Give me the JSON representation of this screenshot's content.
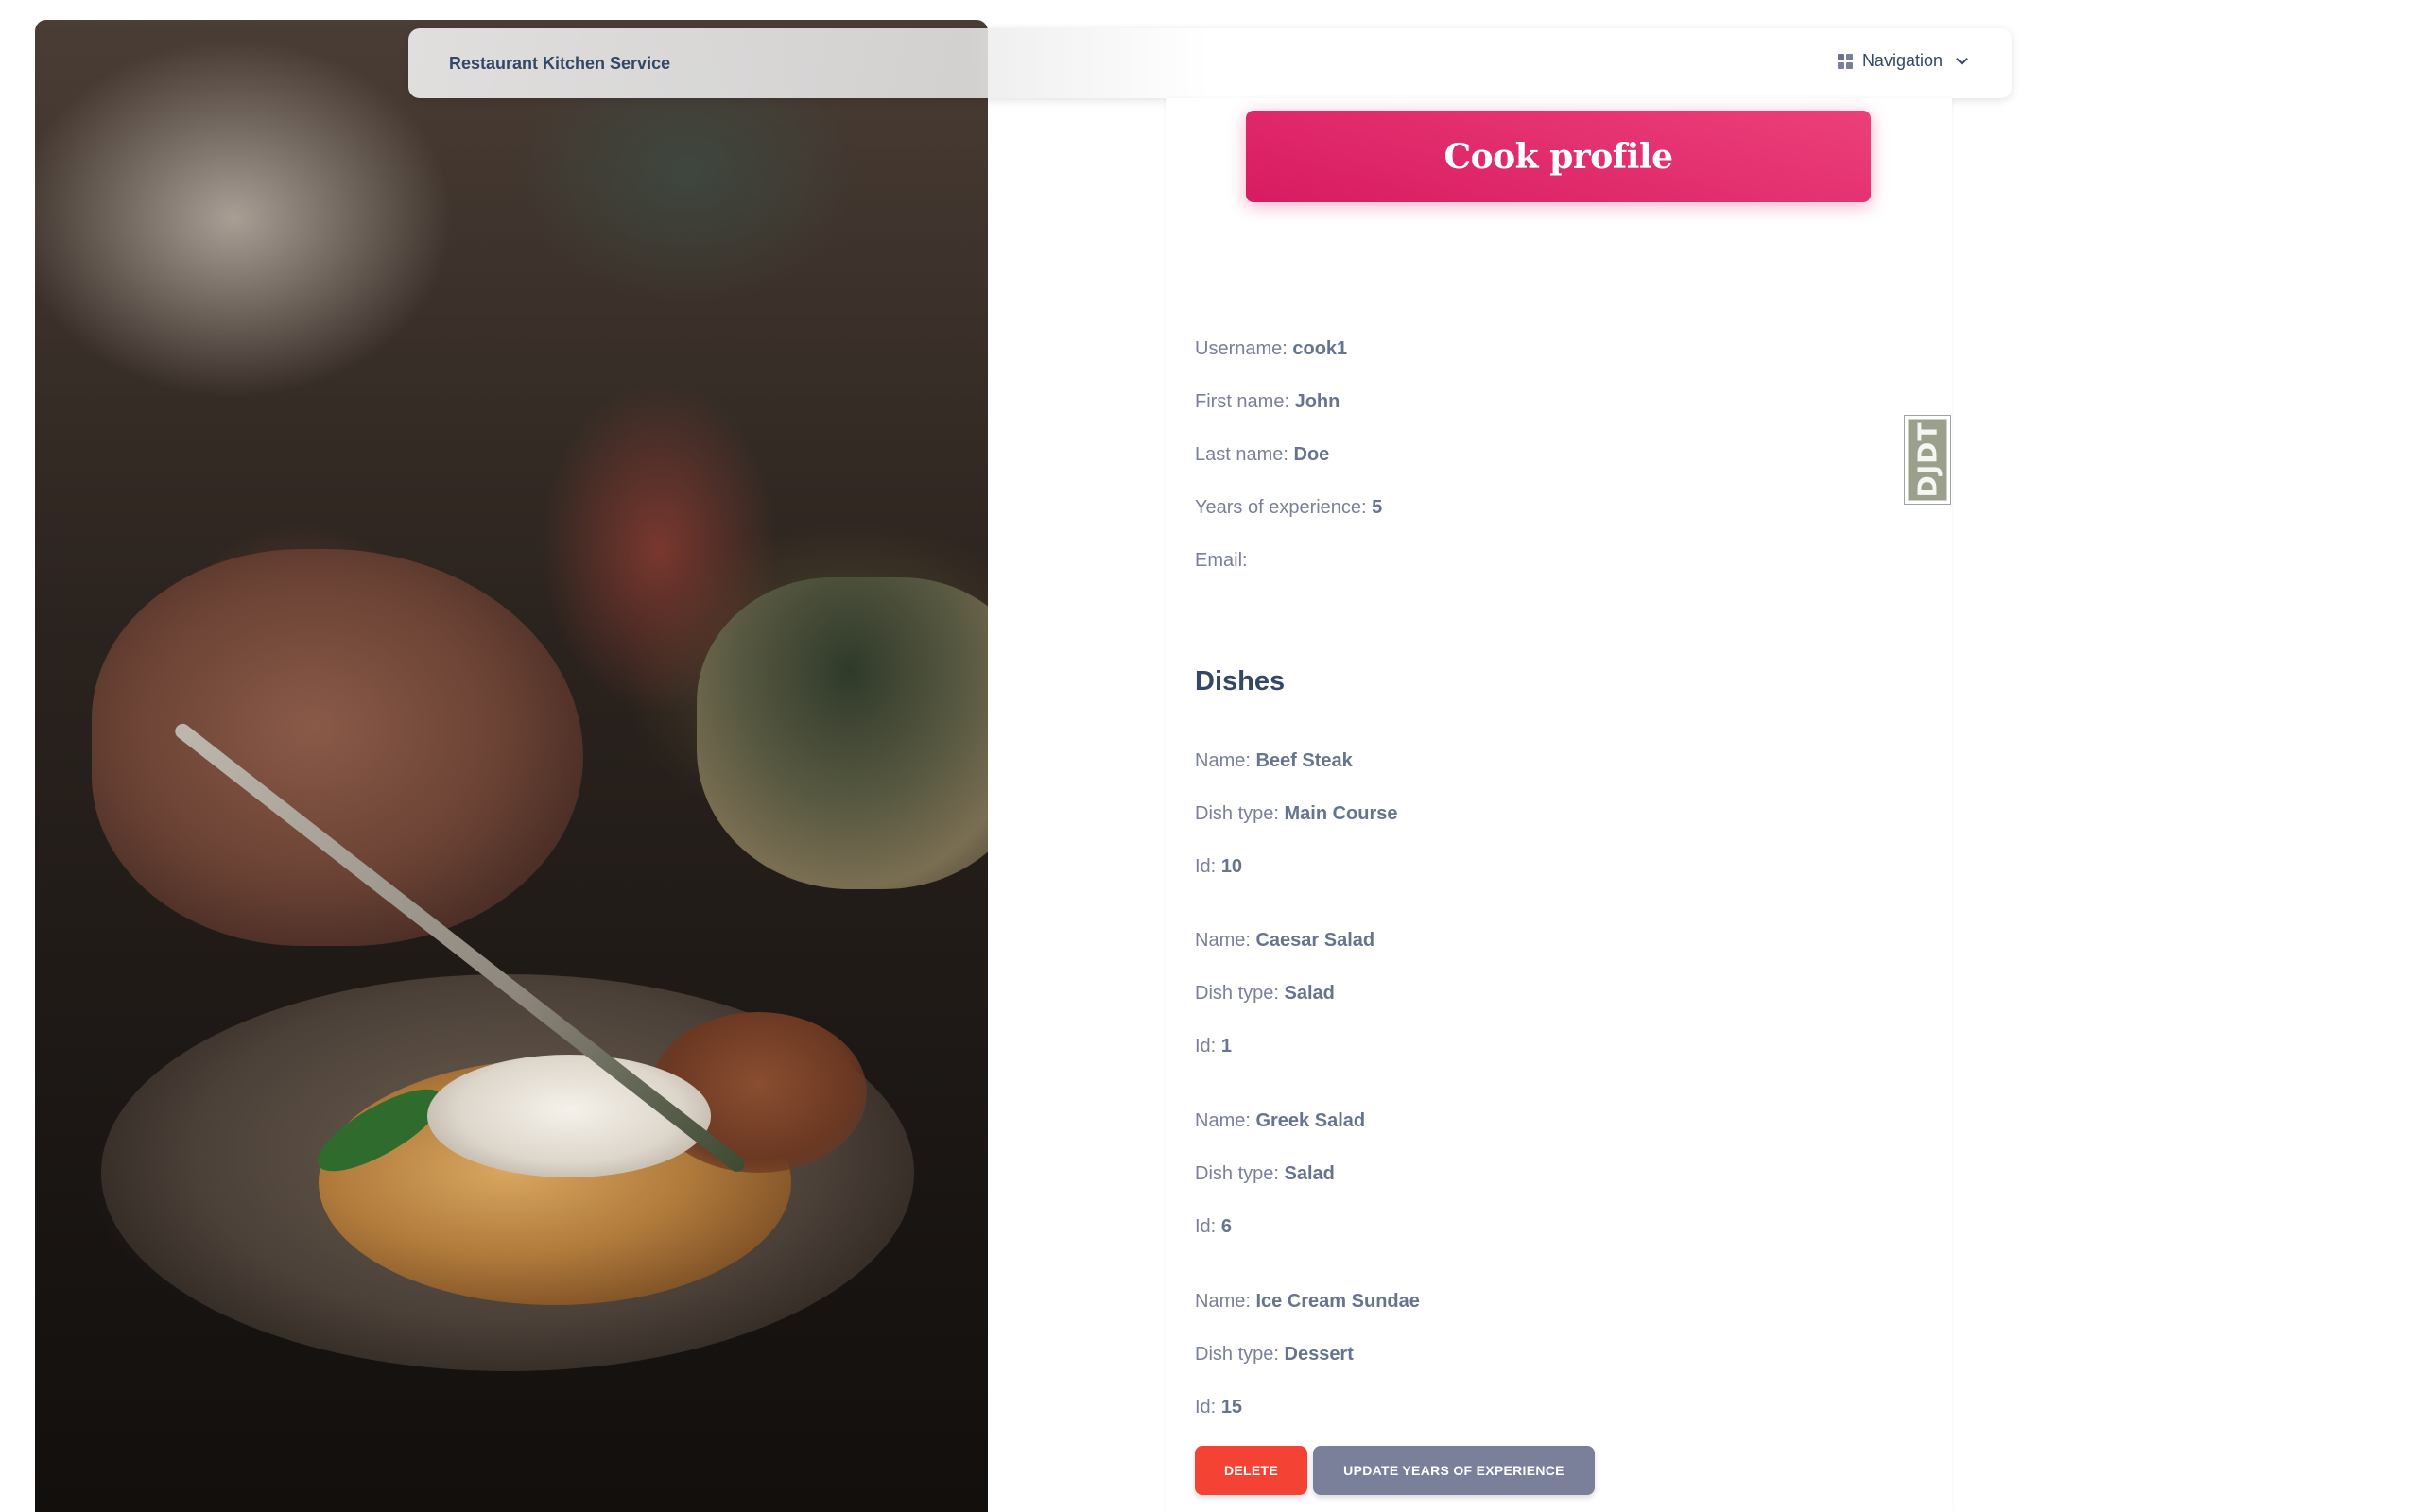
{
  "navbar": {
    "brand": "Restaurant Kitchen Service",
    "nav_label": "Navigation"
  },
  "header": {
    "title": "Cook profile"
  },
  "profile": {
    "fields": [
      {
        "label": "Username:",
        "value": "cook1"
      },
      {
        "label": "First name:",
        "value": "John"
      },
      {
        "label": "Last name:",
        "value": "Doe"
      },
      {
        "label": "Years of experience:",
        "value": "5"
      },
      {
        "label": "Email:",
        "value": ""
      }
    ]
  },
  "dishes": {
    "title": "Dishes",
    "name_label": "Name:",
    "type_label": "Dish type:",
    "id_label": "Id:",
    "items": [
      {
        "name": "Beef Steak",
        "type": "Main Course",
        "id": "10"
      },
      {
        "name": "Caesar Salad",
        "type": "Salad",
        "id": "1"
      },
      {
        "name": "Greek Salad",
        "type": "Salad",
        "id": "6"
      },
      {
        "name": "Ice Cream Sundae",
        "type": "Dessert",
        "id": "15"
      }
    ]
  },
  "actions": {
    "delete_label": "DELETE",
    "update_label": "UPDATE YEARS OF EXPERIENCE"
  },
  "debug_toolbar": {
    "label": "DJDT"
  },
  "colors": {
    "primary_gradient_start": "#ec407a",
    "primary_gradient_end": "#d81b60",
    "danger": "#f44335",
    "secondary": "#7b809a",
    "heading": "#344767"
  },
  "icons": {
    "nav_icon": "grid-icon",
    "nav_caret": "chevron-down-icon"
  }
}
